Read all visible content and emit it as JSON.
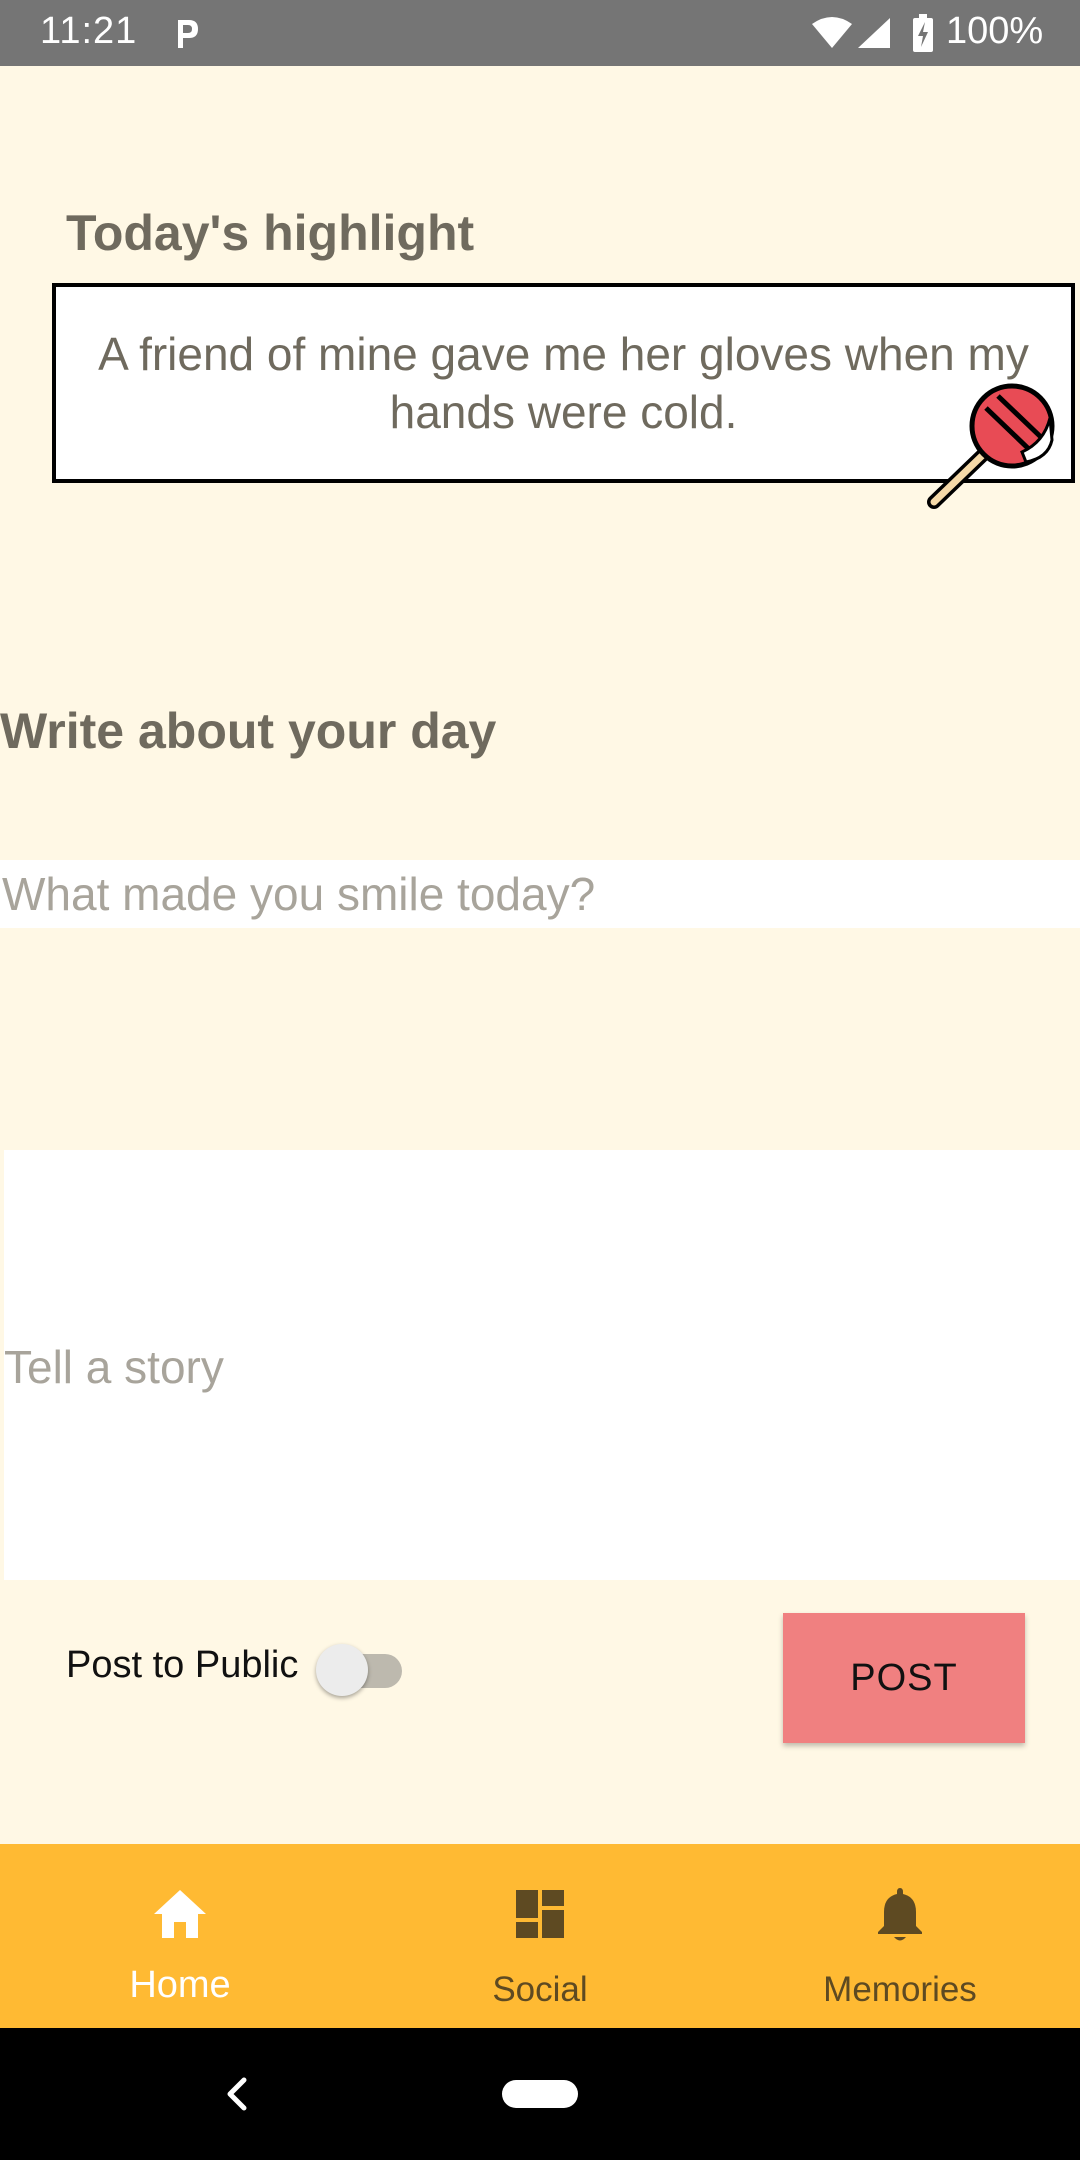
{
  "status_bar": {
    "time": "11:21",
    "battery": "100%",
    "icons": [
      "parking-icon",
      "wifi-icon",
      "signal-icon",
      "battery-charging-icon"
    ]
  },
  "highlight": {
    "title": "Today's highlight",
    "text": "A friend of mine gave me her gloves when my hands were cold.",
    "icon": "lollipop-icon"
  },
  "write": {
    "title": "Write about your day",
    "smile_placeholder": "What made you smile today?",
    "story_placeholder": "Tell a story"
  },
  "post_row": {
    "public_label": "Post to Public",
    "public_enabled": false,
    "post_label": "POST"
  },
  "bottom_nav": {
    "items": [
      {
        "label": "Home",
        "icon": "home-icon",
        "active": true
      },
      {
        "label": "Social",
        "icon": "dashboard-icon",
        "active": false
      },
      {
        "label": "Memories",
        "icon": "bell-icon",
        "active": false
      }
    ]
  },
  "colors": {
    "background": "#FFF8E5",
    "accent": "#FFBA33",
    "post_button": "#F08080",
    "heading_text": "#6F6A5E"
  }
}
